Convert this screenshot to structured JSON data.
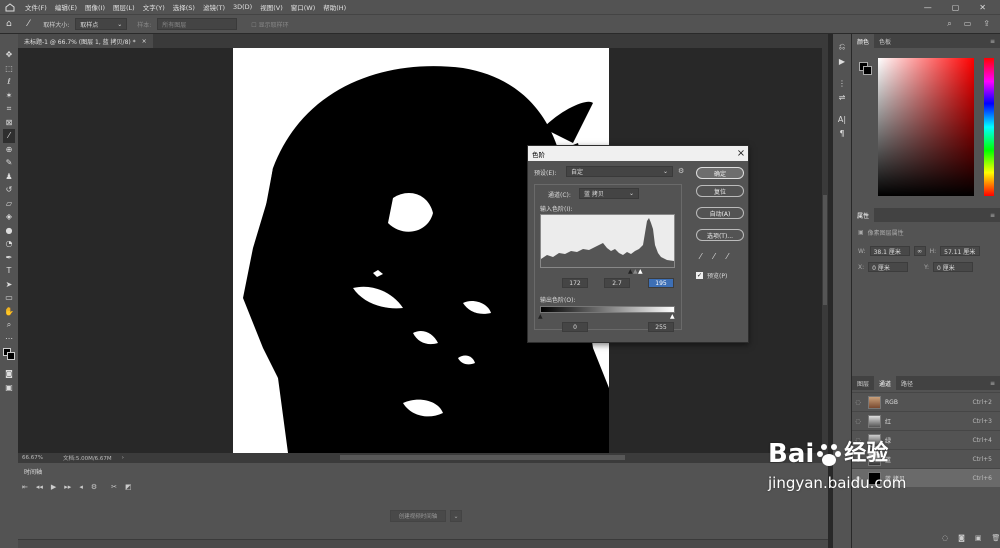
{
  "menubar": {
    "items": [
      "文件(F)",
      "编辑(E)",
      "图像(I)",
      "图层(L)",
      "文字(Y)",
      "选择(S)",
      "滤镜(T)",
      "3D(D)",
      "视图(V)",
      "窗口(W)",
      "帮助(H)"
    ]
  },
  "options": {
    "sample_size_label": "取样大小:",
    "sample_size_value": "取样点",
    "sample_label": "样本:",
    "sample_value": "所有图层",
    "show_ring": "显示取样环"
  },
  "document": {
    "tab_title": "未标题-1 @ 66.7% (图层 1, 蓝 拷贝/8) *",
    "close": "×"
  },
  "status": {
    "zoom": "66.67%",
    "doc_info": "文档:5.00M/6.67M"
  },
  "timeline": {
    "tab": "时间轴",
    "create_button": "创建视频时间轴"
  },
  "color_panel": {
    "tabs": [
      "颜色",
      "色板"
    ]
  },
  "properties_panel": {
    "tab": "属性",
    "title": "像素图层属性",
    "w_label": "W:",
    "w_value": "38.1 厘米",
    "h_label": "H:",
    "h_value": "57.11 厘米",
    "x_label": "X:",
    "x_value": "0 厘米",
    "y_label": "Y:",
    "y_value": "0 厘米",
    "link": "∞"
  },
  "channels_panel": {
    "tabs": [
      "图层",
      "通道",
      "路径"
    ],
    "rows": [
      {
        "name": "RGB",
        "shortcut": "Ctrl+2"
      },
      {
        "name": "红",
        "shortcut": "Ctrl+3"
      },
      {
        "name": "绿",
        "shortcut": "Ctrl+4"
      },
      {
        "name": "蓝",
        "shortcut": "Ctrl+5"
      },
      {
        "name": "蓝 拷贝",
        "shortcut": "Ctrl+6"
      }
    ]
  },
  "levels_dialog": {
    "title": "色阶",
    "close": "×",
    "preset_label": "预设(E):",
    "preset_value": "自定",
    "channel_label": "通道(C):",
    "channel_value": "蓝 拷贝",
    "input_label": "输入色阶(I):",
    "input_values": [
      "172",
      "2.7",
      "195"
    ],
    "output_label": "输出色阶(O):",
    "output_values": [
      "0",
      "255"
    ],
    "buttons": {
      "ok": "确定",
      "reset": "复位",
      "auto": "自动(A)",
      "options": "选项(T)..."
    },
    "preview_label": "预览(P)",
    "preview_checked": true
  },
  "watermark": {
    "brand": "Bai",
    "brand_cn": "经验",
    "url": "jingyan.baidu.com"
  }
}
